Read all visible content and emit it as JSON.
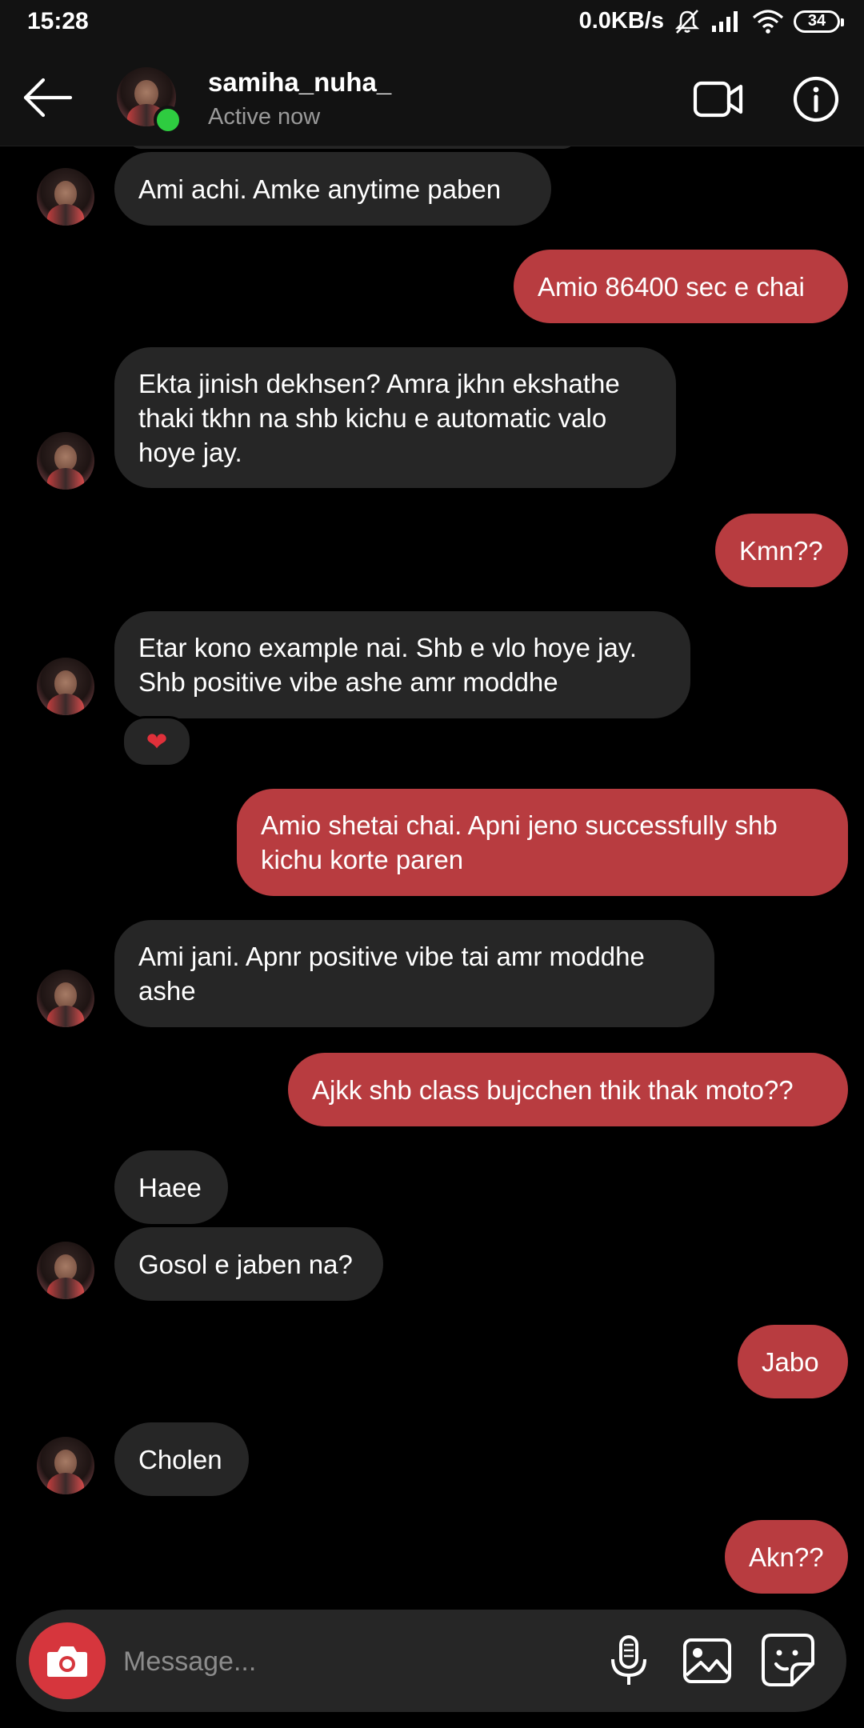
{
  "status_bar": {
    "time": "15:28",
    "network_speed": "0.0KB/s",
    "battery": "34"
  },
  "header": {
    "username": "samiha_nuha_",
    "status": "Active now"
  },
  "messages": [
    {
      "from": "them",
      "text": "Ami achi. Amke anytime paben"
    },
    {
      "from": "me",
      "text": "Amio 86400 sec e chai"
    },
    {
      "from": "them",
      "text": "Ekta jinish dekhsen? Amra jkhn ekshathe thaki tkhn na shb kichu e automatic valo hoye jay."
    },
    {
      "from": "me",
      "text": "Kmn??"
    },
    {
      "from": "them",
      "text": "Etar kono example nai. Shb e vlo hoye jay. Shb positive vibe ashe amr moddhe",
      "reaction": "❤"
    },
    {
      "from": "me",
      "text": "Amio shetai chai. Apni jeno successfully shb kichu korte paren"
    },
    {
      "from": "them",
      "text": "Ami jani. Apnr positive vibe tai amr moddhe ashe"
    },
    {
      "from": "me",
      "text": "Ajkk shb class bujcchen thik thak moto??"
    },
    {
      "from": "them",
      "text": "Haee"
    },
    {
      "from": "them",
      "text": "Gosol e jaben na?"
    },
    {
      "from": "me",
      "text": "Jabo"
    },
    {
      "from": "them",
      "text": "Cholen"
    },
    {
      "from": "me",
      "text": "Akn??"
    }
  ],
  "composer": {
    "placeholder": "Message..."
  },
  "colors": {
    "outgoing_bubble": "#b83c40",
    "incoming_bubble": "#262626",
    "online": "#2ecc40",
    "camera_button": "#d6363d"
  }
}
